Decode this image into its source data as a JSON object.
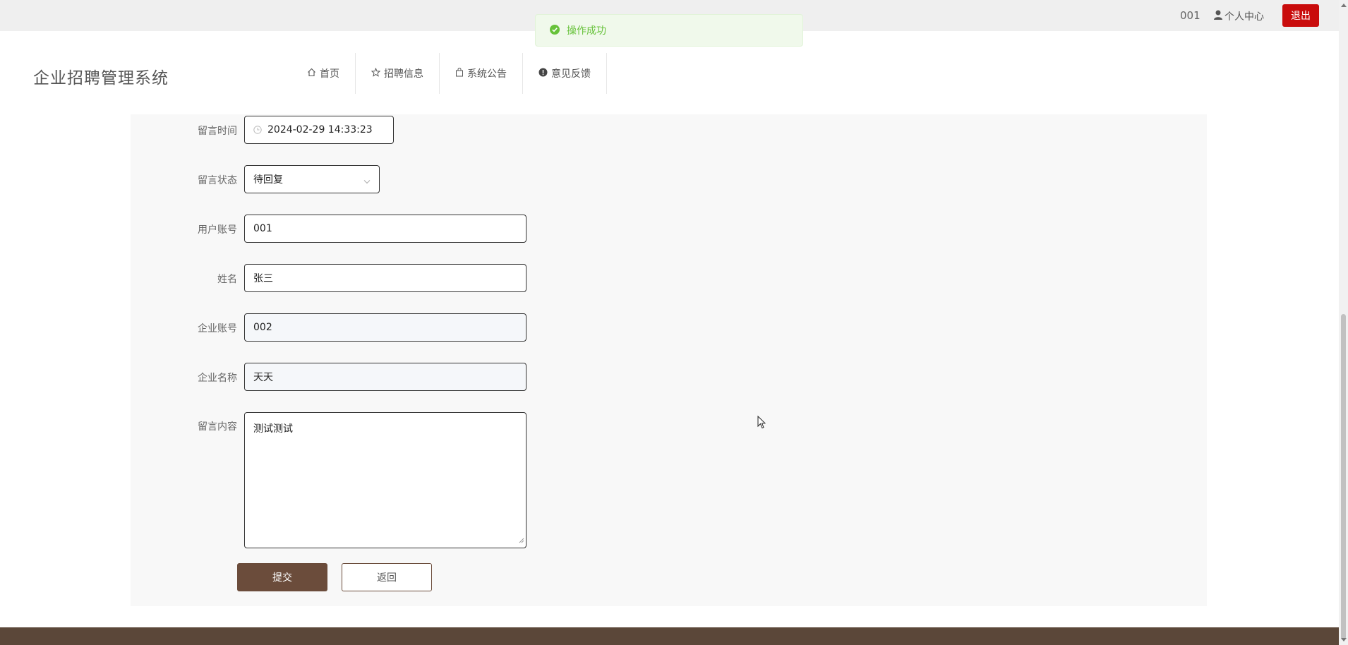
{
  "topbar": {
    "username": "001",
    "profile_label": "个人中心",
    "logout_label": "退出"
  },
  "toast": {
    "message": "操作成功",
    "accent": "#67c23a"
  },
  "brand": {
    "title": "企业招聘管理系统"
  },
  "nav": [
    {
      "label": "首页",
      "icon": "home-icon"
    },
    {
      "label": "招聘信息",
      "icon": "star-icon"
    },
    {
      "label": "系统公告",
      "icon": "bag-icon"
    },
    {
      "label": "意见反馈",
      "icon": "alert-icon"
    }
  ],
  "form": {
    "time_label": "留言时间",
    "time_value": "2024-02-29 14:33:23",
    "status_label": "留言状态",
    "status_value": "待回复",
    "account_label": "用户账号",
    "account_value": "001",
    "name_label": "姓名",
    "name_value": "张三",
    "company_account_label": "企业账号",
    "company_account_value": "002",
    "company_name_label": "企业名称",
    "company_name_value": "天天",
    "content_label": "留言内容",
    "content_value": "测试测试",
    "submit_label": "提交",
    "back_label": "返回"
  },
  "colors": {
    "primary": "#6b4c3b",
    "logout": "#c90c0c",
    "footer": "#5b4739"
  }
}
